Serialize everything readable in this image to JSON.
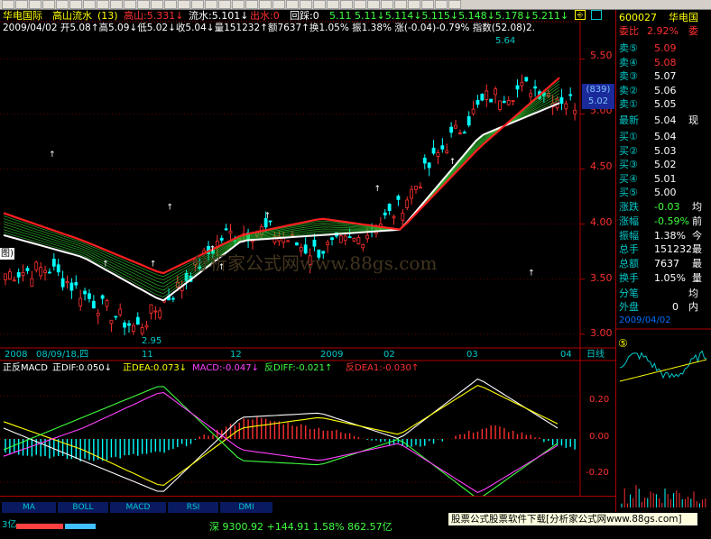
{
  "toolbar": {
    "count": 34
  },
  "header": {
    "stock_name": "华电国际",
    "indicator": "高山流水",
    "indicator_param": "(13)",
    "items": [
      {
        "label": "高山:5.331↓",
        "color": "#ff3030"
      },
      {
        "label": "流水:5.101↓",
        "color": "#ffffff"
      },
      {
        "label": "出水:0",
        "color": "#ff3030"
      },
      {
        "label": "回踩:0",
        "color": "#ffffff"
      }
    ],
    "sequence": "5.11  5.11↓5.114↓5.115↓5.148↓5.178↓5.211↓",
    "quote_line": "2009/04/02  开5.08↑高5.09↓低5.02↓收5.04↓量151232↑额7637↑换1.05%  振1.38%  涨(-0.04)-0.79%  指数(52.08)2."
  },
  "price_axis": [
    "5.50",
    "5.00",
    "4.50",
    "4.00",
    "3.50",
    "3.00"
  ],
  "annotations": {
    "high": "5.64",
    "low": "2.95",
    "mid_label": "图)",
    "price_box": "(839)",
    "price_box_value": "5.02"
  },
  "date_axis": {
    "labels": [
      "2008",
      "08/09/18,四",
      "11",
      "12",
      "2009",
      "02",
      "03",
      "04"
    ],
    "period": "日线"
  },
  "watermark": "分析家公式网www.88gs.com",
  "macd_header": [
    {
      "text": "正反MACD",
      "color": "#ffffff"
    },
    {
      "text": "正DIF:0.050↓",
      "color": "#ffffff"
    },
    {
      "text": "正DEA:0.073↓",
      "color": "#ffff00"
    },
    {
      "text": "MACD:-0.047↓",
      "color": "#ff40ff"
    },
    {
      "text": "反DIFF:-0.021↑",
      "color": "#40ff40"
    },
    {
      "text": "反DEA1:-0.030↑",
      "color": "#ff3030"
    }
  ],
  "macd_axis": [
    "0.20",
    "0.00",
    "-0.20"
  ],
  "tabs": [
    "MA",
    "BOLL",
    "MACD",
    "RSI",
    "DMI"
  ],
  "right_panel": {
    "code": "600027",
    "name": "华电国",
    "ratio_label": "委比",
    "ratio_value": "2.92%",
    "ratio_tail": "委",
    "sells": [
      {
        "label": "卖⑤",
        "price": "5.09"
      },
      {
        "label": "卖④",
        "price": "5.08"
      },
      {
        "label": "卖③",
        "price": "5.07"
      },
      {
        "label": "卖②",
        "price": "5.06"
      },
      {
        "label": "卖①",
        "price": "5.05"
      }
    ],
    "last_label": "最新",
    "last_value": "5.04",
    "last_tail": "现",
    "buys": [
      {
        "label": "买①",
        "price": "5.04"
      },
      {
        "label": "买②",
        "price": "5.03"
      },
      {
        "label": "买③",
        "price": "5.02"
      },
      {
        "label": "买④",
        "price": "5.01"
      },
      {
        "label": "买⑤",
        "price": "5.00"
      }
    ],
    "stats": [
      {
        "label": "涨跌",
        "value": "-0.03",
        "tail": "均"
      },
      {
        "label": "涨幅",
        "value": "-0.59%",
        "tail": "前"
      },
      {
        "label": "振幅",
        "value": "1.38%",
        "tail": "今"
      },
      {
        "label": "总手",
        "value": "151232",
        "tail": "最"
      },
      {
        "label": "总额",
        "value": "7637",
        "tail": "最"
      },
      {
        "label": "换手",
        "value": "1.05%",
        "tail": "量"
      }
    ],
    "fenbi": "分笔",
    "fenbi_tail": "均",
    "waipan": "外盘",
    "waipan_value": "0",
    "neipan": "内",
    "date": "2009/04/02",
    "mini_badge": "⑤"
  },
  "bottom": {
    "left": "3亿",
    "index": "深 9300.92  +144.91  1.58%  862.57亿",
    "promo": "股票公式股票软件下载[分析家公式网www.88gs.com]"
  },
  "colors": {
    "up": "#ff3030",
    "down": "#00ffff",
    "axis": "#b00000",
    "label": "#ff3030"
  },
  "chart_data": [
    {
      "type": "line",
      "title": "华电国际 日线",
      "x": [
        "2008-09",
        "2008-10",
        "2008-11",
        "2008-12",
        "2009-01",
        "2009-02",
        "2009-03",
        "2009-04"
      ],
      "series": [
        {
          "name": "高山",
          "values": [
            4.1,
            3.85,
            3.55,
            3.9,
            4.05,
            3.95,
            4.7,
            5.33
          ]
        },
        {
          "name": "流水",
          "values": [
            3.9,
            3.7,
            3.3,
            3.85,
            3.9,
            3.95,
            4.8,
            5.1
          ]
        }
      ],
      "ylim": [
        2.9,
        5.7
      ],
      "annotations": {
        "max": 5.64,
        "min": 2.95
      }
    },
    {
      "type": "line",
      "title": "正反MACD",
      "series": [
        {
          "name": "正DIF",
          "values": [
            0.05,
            -0.1,
            -0.25,
            0.1,
            0.12,
            0.0,
            0.28,
            0.05
          ]
        },
        {
          "name": "正DEA",
          "values": [
            0.08,
            -0.05,
            -0.22,
            0.05,
            0.1,
            0.02,
            0.25,
            0.07
          ]
        },
        {
          "name": "MACD",
          "values": [
            -0.06,
            -0.1,
            -0.06,
            0.1,
            0.04,
            -0.04,
            0.06,
            -0.05
          ]
        },
        {
          "name": "反DIFF",
          "values": [
            -0.05,
            0.1,
            0.25,
            -0.1,
            -0.12,
            0.0,
            -0.28,
            -0.02
          ]
        },
        {
          "name": "反DEA1",
          "values": [
            -0.08,
            0.05,
            0.22,
            -0.05,
            -0.1,
            -0.02,
            -0.25,
            -0.03
          ]
        }
      ],
      "ylim": [
        -0.25,
        0.3
      ]
    }
  ]
}
